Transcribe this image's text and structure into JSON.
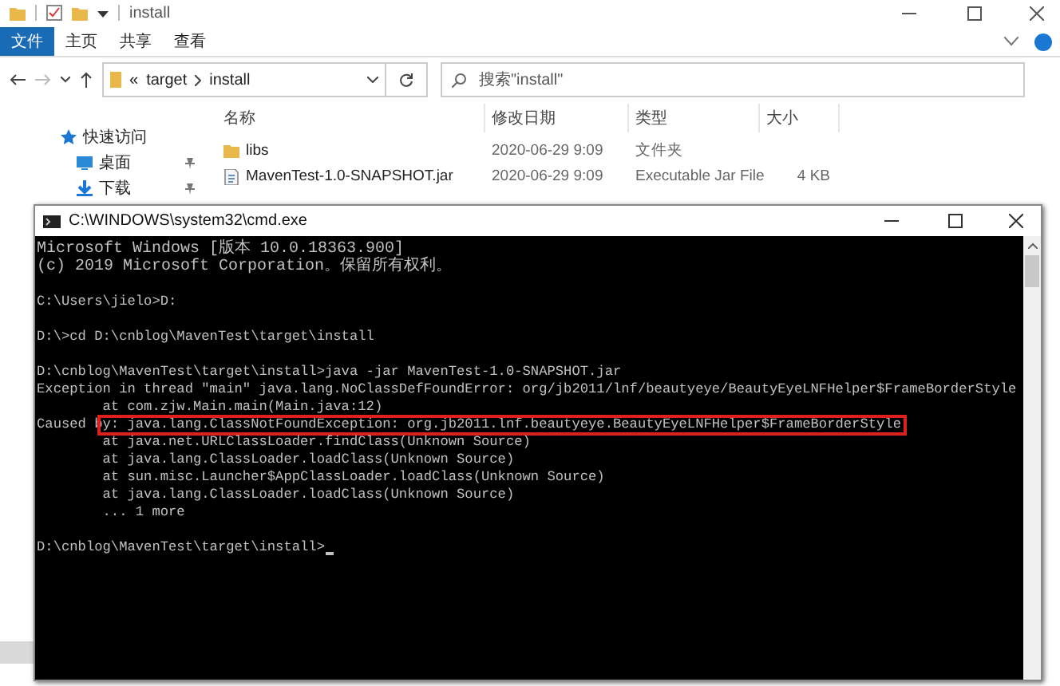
{
  "explorer": {
    "title": "install",
    "ribbon_tabs": [
      {
        "label": "文件",
        "selected": true
      },
      {
        "label": "主页",
        "selected": false
      },
      {
        "label": "共享",
        "selected": false
      },
      {
        "label": "查看",
        "selected": false
      }
    ],
    "breadcrumb": [
      "«",
      "target",
      "install"
    ],
    "search": {
      "placeholder": "搜索\"install\""
    },
    "sidebar": [
      {
        "label": "快速访问",
        "kind": "star",
        "pinned": false
      },
      {
        "label": "桌面",
        "kind": "desktop",
        "pinned": true
      },
      {
        "label": "下载",
        "kind": "download",
        "pinned": true
      }
    ],
    "columns": [
      "名称",
      "修改日期",
      "类型",
      "大小"
    ],
    "rows": [
      {
        "kind": "folder",
        "name": "libs",
        "modified": "2020-06-29 9:09",
        "type": "文件夹"
      },
      {
        "kind": "jar",
        "name": "MavenTest-1.0-SNAPSHOT.jar",
        "modified": "2020-06-29 9:09",
        "type": "Executable Jar File",
        "size": "4 KB"
      }
    ]
  },
  "console": {
    "title": "C:\\WINDOWS\\system32\\cmd.exe",
    "lines": [
      {
        "text": "Microsoft Windows [版本 10.0.18363.900]",
        "highlighted": false
      },
      {
        "text": "(c) 2019 Microsoft Corporation。保留所有权利。",
        "highlighted": false
      },
      {
        "highlighted": false
      },
      {
        "text": "C:\\Users\\jielo>D:",
        "highlighted": false
      },
      {
        "highlighted": false
      },
      {
        "text": "D:\\>cd D:\\cnblog\\MavenTest\\target\\install",
        "highlighted": false
      },
      {
        "highlighted": false
      },
      {
        "text": "D:\\cnblog\\MavenTest\\target\\install>java -jar MavenTest-1.0-SNAPSHOT.jar",
        "highlighted": false
      },
      {
        "text": "Exception in thread \"main\" java.lang.NoClassDefFoundError: org/jb2011/lnf/beautyeye/BeautyEyeLNFHelper$FrameBorderStyle",
        "highlighted": false
      },
      {
        "text": "        at com.zjw.Main.main(Main.java:12)",
        "highlighted": false
      },
      {
        "text": "Caused by: java.lang.ClassNotFoundException: org.jb2011.lnf.beautyeye.BeautyEyeLNFHelper$FrameBorderStyle",
        "highlighted": true
      },
      {
        "text": "        at java.net.URLClassLoader.findClass(Unknown Source)",
        "highlighted": false
      },
      {
        "text": "        at java.lang.ClassLoader.loadClass(Unknown Source)",
        "highlighted": false
      },
      {
        "text": "        at sun.misc.Launcher$AppClassLoader.loadClass(Unknown Source)",
        "highlighted": false
      },
      {
        "text": "        at java.lang.ClassLoader.loadClass(Unknown Source)",
        "highlighted": false
      },
      {
        "text": "        ... 1 more",
        "highlighted": false
      },
      {
        "highlighted": false
      },
      {
        "text": "D:\\cnblog\\MavenTest\\target\\install>",
        "highlighted": false,
        "cursor": true
      }
    ]
  }
}
